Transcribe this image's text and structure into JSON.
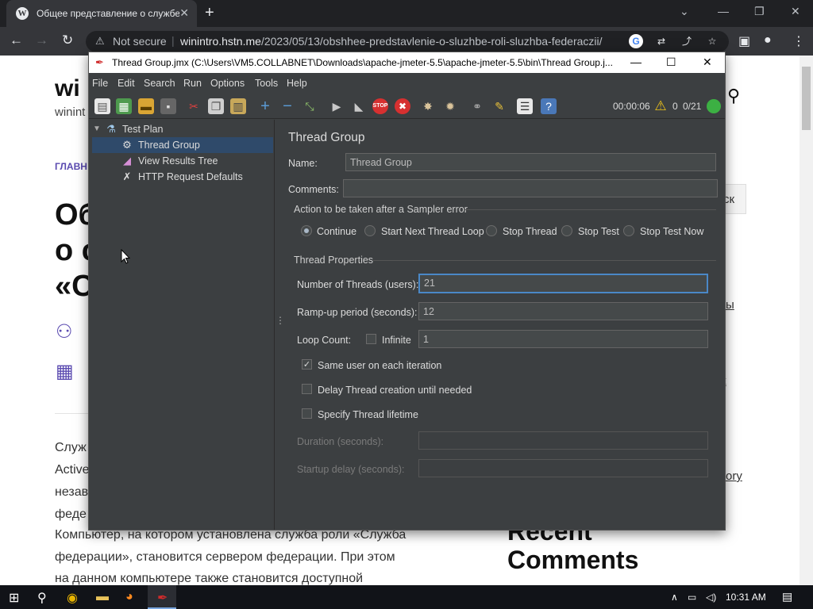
{
  "browser": {
    "tab_title": "Общее представление о службе",
    "url_not_secure": "Not secure",
    "url_host": "winintro.hstn.me",
    "url_path": "/2023/05/13/obshhee-predstavlenie-o-sluzhbe-roli-sluzhba-federaczii/"
  },
  "webpage": {
    "site_title": "wi",
    "site_sub": "winint",
    "crumb": "ГЛАВН",
    "heading_lines": [
      "Об",
      "о с",
      "«С"
    ],
    "body_lines": [
      "Служ",
      "Active",
      "незав",
      "феде",
      "Компьютер, на котором установлена служба роли «Служба",
      "федерации», становится сервером федерации. При этом",
      "на данном компьютере также становится доступной"
    ],
    "recent_title_1": "Recent",
    "recent_title_2": "Comments",
    "search_button": "ск",
    "side_link_1": "ы",
    "side_link_2": "к",
    "side_link_3": "ory"
  },
  "jmeter": {
    "window_title": "Thread Group.jmx (C:\\Users\\VM5.COLLABNET\\Downloads\\apache-jmeter-5.5\\apache-jmeter-5.5\\bin\\Thread Group.j...",
    "menu": [
      "File",
      "Edit",
      "Search",
      "Run",
      "Options",
      "Tools",
      "Help"
    ],
    "status": {
      "elapsed": "00:00:06",
      "errors": "0",
      "threads": "0/21"
    },
    "tree": {
      "root": "Test Plan",
      "items": [
        "Thread Group",
        "View Results Tree",
        "HTTP Request Defaults"
      ]
    },
    "panel": {
      "title": "Thread Group",
      "name_label": "Name:",
      "name_value": "Thread Group",
      "comments_label": "Comments:",
      "comments_value": "",
      "action_group_title": "Action to be taken after a Sampler error",
      "actions": [
        "Continue",
        "Start Next Thread Loop",
        "Stop Thread",
        "Stop Test",
        "Stop Test Now"
      ],
      "selected_action": "Continue",
      "props_title": "Thread Properties",
      "threads_label": "Number of Threads (users):",
      "threads_value": "21",
      "rampup_label": "Ramp-up period (seconds):",
      "rampup_value": "12",
      "loop_label": "Loop Count:",
      "infinite_label": "Infinite",
      "loop_value": "1",
      "same_user_label": "Same user on each iteration",
      "delay_label": "Delay Thread creation until needed",
      "lifetime_label": "Specify Thread lifetime",
      "duration_label": "Duration (seconds):",
      "startup_label": "Startup delay (seconds):"
    }
  },
  "taskbar": {
    "time": "10:31 AM"
  }
}
